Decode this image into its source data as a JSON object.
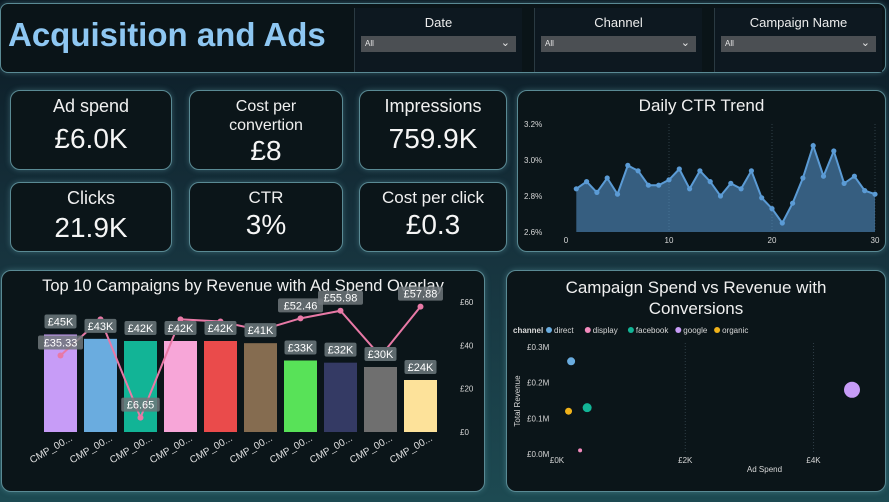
{
  "header": {
    "title": "Acquisition and Ads",
    "slicers": [
      {
        "label": "Date",
        "value": "All"
      },
      {
        "label": "Channel",
        "value": "All"
      },
      {
        "label": "Campaign Name",
        "value": "All"
      }
    ]
  },
  "kpis": {
    "ad_spend": {
      "label": "Ad spend",
      "value": "£6.0K"
    },
    "cost_per_conversion": {
      "label": "Cost per convertion",
      "value": "£8"
    },
    "impressions": {
      "label": "Impressions",
      "value": "759.9K"
    },
    "clicks": {
      "label": "Clicks",
      "value": "21.9K"
    },
    "ctr": {
      "label": "CTR",
      "value": "3%"
    },
    "cost_per_click": {
      "label": "Cost per click",
      "value": "£0.3"
    }
  },
  "colors": {
    "accent": "#8ec7f2",
    "line": "#e879a6",
    "area": "#5b9bd5"
  },
  "chart_data": [
    {
      "type": "area",
      "title": "Daily CTR Trend",
      "x": [
        1,
        2,
        3,
        4,
        5,
        6,
        7,
        8,
        9,
        10,
        11,
        12,
        13,
        14,
        15,
        16,
        17,
        18,
        19,
        20,
        21,
        22,
        23,
        24,
        25,
        26,
        27,
        28,
        29,
        30
      ],
      "values": [
        2.84,
        2.88,
        2.82,
        2.9,
        2.81,
        2.97,
        2.94,
        2.86,
        2.86,
        2.89,
        2.95,
        2.84,
        2.94,
        2.88,
        2.8,
        2.87,
        2.84,
        2.94,
        2.79,
        2.73,
        2.65,
        2.76,
        2.9,
        3.08,
        2.91,
        3.05,
        2.87,
        2.91,
        2.83,
        2.81
      ],
      "yticks": [
        "3.2%",
        "3.0%",
        "2.8%",
        "2.6%"
      ],
      "ylim": [
        2.6,
        3.2
      ],
      "xticks": [
        "0",
        "10",
        "20",
        "30"
      ],
      "grid": false
    },
    {
      "type": "bar",
      "title": "Top 10 Campaigns by Revenue with Ad Spend Overlay",
      "categories": [
        "CMP_00...",
        "CMP_00...",
        "CMP_00...",
        "CMP_00...",
        "CMP_00...",
        "CMP_00...",
        "CMP_00...",
        "CMP_00...",
        "CMP_00...",
        "CMP_00..."
      ],
      "series": [
        {
          "values": [
            45,
            43,
            42,
            42,
            42,
            41,
            33,
            32,
            30,
            24
          ],
          "labels": [
            "£45K",
            "£43K",
            "£42K",
            "£42K",
            "£42K",
            "£41K",
            "£33K",
            "£32K",
            "£30K",
            "£24K"
          ],
          "colors": [
            "#c79cf7",
            "#6aacdf",
            "#12b496",
            "#f7a6d8",
            "#ea4b4b",
            "#856c50",
            "#58e258",
            "#343a64",
            "#6f6f6f",
            "#fde29a"
          ]
        },
        {
          "type": "line",
          "values": [
            35.33,
            52,
            6.65,
            52,
            51,
            47,
            52.46,
            55.98,
            35,
            57.88
          ],
          "labels": [
            "£35.33",
            "",
            "£6.65",
            "",
            "",
            "",
            "£52.46",
            "£55.98",
            "",
            "£57.88"
          ]
        }
      ],
      "secondary_yticks": [
        "£60",
        "£40",
        "£20",
        "£0"
      ],
      "secondary_ylim": [
        0,
        60
      ]
    },
    {
      "type": "scatter",
      "title": "Campaign Spend vs Revenue with Conversions",
      "legend_title": "channel",
      "legend": [
        {
          "name": "direct",
          "color": "#6aacdf"
        },
        {
          "name": "display",
          "color": "#f38bbd"
        },
        {
          "name": "facebook",
          "color": "#12b496"
        },
        {
          "name": "google",
          "color": "#c79cf7"
        },
        {
          "name": "organic",
          "color": "#f0b21a"
        }
      ],
      "xlabel": "Ad Spend",
      "ylabel": "Total Revenue",
      "xticks": [
        "£0K",
        "£2K",
        "£4K"
      ],
      "yticks": [
        "£0.3M",
        "£0.2M",
        "£0.1M",
        "£0.0M"
      ],
      "xlim": [
        0,
        4.6
      ],
      "ylim": [
        0,
        0.3
      ],
      "points": [
        {
          "channel": "direct",
          "x": 0.22,
          "y": 0.26,
          "size": 4
        },
        {
          "channel": "organic",
          "x": 0.18,
          "y": 0.12,
          "size": 3.5
        },
        {
          "channel": "facebook",
          "x": 0.47,
          "y": 0.13,
          "size": 4.5
        },
        {
          "channel": "display",
          "x": 0.36,
          "y": 0.01,
          "size": 2
        },
        {
          "channel": "google",
          "x": 4.6,
          "y": 0.18,
          "size": 8
        }
      ]
    }
  ]
}
